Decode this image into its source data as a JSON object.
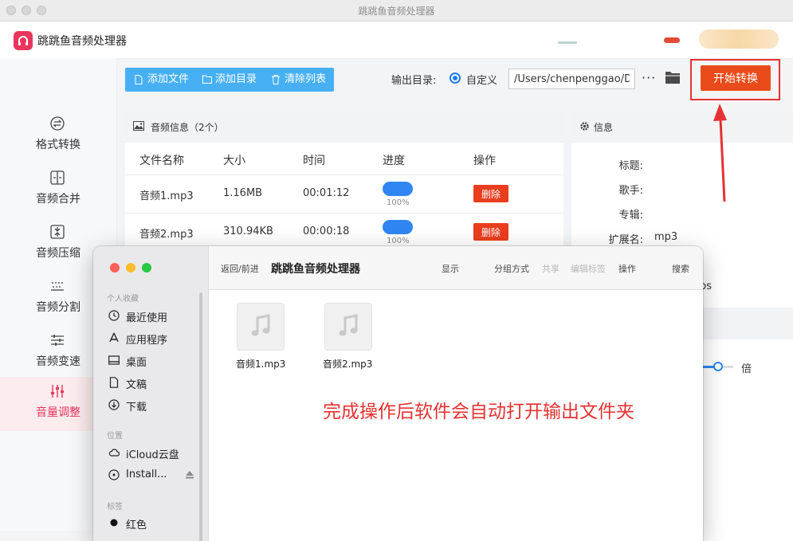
{
  "window": {
    "title": "跳跳鱼音频处理器"
  },
  "app": {
    "name": "跳跳鱼音频处理器"
  },
  "sidebar": {
    "items": [
      {
        "label": "格式转换",
        "icon": "format-convert-icon"
      },
      {
        "label": "音频合并",
        "icon": "merge-icon"
      },
      {
        "label": "音频压缩",
        "icon": "compress-icon"
      },
      {
        "label": "音频分割",
        "icon": "split-icon"
      },
      {
        "label": "音频变速",
        "icon": "speed-icon"
      },
      {
        "label": "音量调整",
        "icon": "volume-icon",
        "active": true
      }
    ]
  },
  "toolbar": {
    "add_file": "添加文件",
    "add_dir": "添加目录",
    "clear_list": "清除列表"
  },
  "output": {
    "label": "输出目录:",
    "mode": "自定义",
    "path": "/Users/chenpenggao/D",
    "more": "···",
    "start": "开始转换"
  },
  "audio_panel": {
    "title": "音频信息（2个）",
    "columns": [
      "文件名称",
      "大小",
      "时间",
      "进度",
      "操作"
    ],
    "rows": [
      {
        "name": "音频1.mp3",
        "size": "1.16MB",
        "time": "00:01:12",
        "progress": "100%",
        "progress_value": 1.0,
        "action": "删除"
      },
      {
        "name": "音频2.mp3",
        "size": "310.94KB",
        "time": "00:00:18",
        "progress": "100%",
        "progress_value": 1.0,
        "action": "删除"
      }
    ]
  },
  "info_panel": {
    "title": "信息",
    "fields": {
      "title": "标题:",
      "artist": "歌手:",
      "album": "专辑:",
      "ext_label": "扩展名:",
      "ext_value": "mp3"
    },
    "partial": "ps",
    "unit": "倍"
  },
  "finder": {
    "nav": "返回/前进",
    "title": "跳跳鱼音频处理器",
    "toolbar": {
      "view": "显示",
      "group": "分组方式",
      "share": "共享",
      "tags": "编辑标签",
      "action": "操作",
      "search": "搜索"
    },
    "sections": {
      "favorites": "个人收藏",
      "locations": "位置",
      "tags": "标签"
    },
    "favorites": [
      "最近使用",
      "应用程序",
      "桌面",
      "文稿",
      "下载"
    ],
    "locations": [
      "iCloud云盘",
      "Install..."
    ],
    "tags": [
      "红色"
    ],
    "files": [
      "音频1.mp3",
      "音频2.mp3"
    ]
  },
  "annotation": {
    "text": "完成操作后软件会自动打开输出文件夹",
    "color": "#e53232"
  },
  "colors": {
    "accent": "#e8365d",
    "toolbar": "#47b0f5",
    "start": "#ea4b1a",
    "delete": "#ea3d1e",
    "progress": "#2f86f3"
  }
}
